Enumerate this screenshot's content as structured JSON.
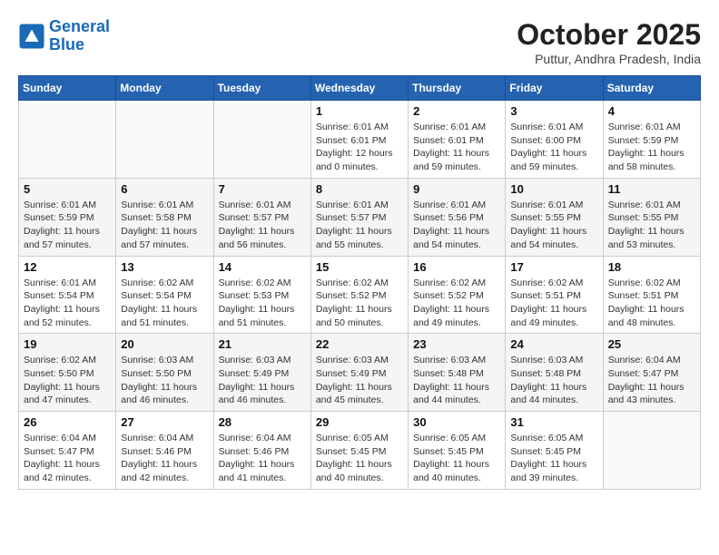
{
  "header": {
    "logo_line1": "General",
    "logo_line2": "Blue",
    "month": "October 2025",
    "location": "Puttur, Andhra Pradesh, India"
  },
  "weekdays": [
    "Sunday",
    "Monday",
    "Tuesday",
    "Wednesday",
    "Thursday",
    "Friday",
    "Saturday"
  ],
  "weeks": [
    [
      {
        "day": "",
        "info": ""
      },
      {
        "day": "",
        "info": ""
      },
      {
        "day": "",
        "info": ""
      },
      {
        "day": "1",
        "info": "Sunrise: 6:01 AM\nSunset: 6:01 PM\nDaylight: 12 hours\nand 0 minutes."
      },
      {
        "day": "2",
        "info": "Sunrise: 6:01 AM\nSunset: 6:01 PM\nDaylight: 11 hours\nand 59 minutes."
      },
      {
        "day": "3",
        "info": "Sunrise: 6:01 AM\nSunset: 6:00 PM\nDaylight: 11 hours\nand 59 minutes."
      },
      {
        "day": "4",
        "info": "Sunrise: 6:01 AM\nSunset: 5:59 PM\nDaylight: 11 hours\nand 58 minutes."
      }
    ],
    [
      {
        "day": "5",
        "info": "Sunrise: 6:01 AM\nSunset: 5:59 PM\nDaylight: 11 hours\nand 57 minutes."
      },
      {
        "day": "6",
        "info": "Sunrise: 6:01 AM\nSunset: 5:58 PM\nDaylight: 11 hours\nand 57 minutes."
      },
      {
        "day": "7",
        "info": "Sunrise: 6:01 AM\nSunset: 5:57 PM\nDaylight: 11 hours\nand 56 minutes."
      },
      {
        "day": "8",
        "info": "Sunrise: 6:01 AM\nSunset: 5:57 PM\nDaylight: 11 hours\nand 55 minutes."
      },
      {
        "day": "9",
        "info": "Sunrise: 6:01 AM\nSunset: 5:56 PM\nDaylight: 11 hours\nand 54 minutes."
      },
      {
        "day": "10",
        "info": "Sunrise: 6:01 AM\nSunset: 5:55 PM\nDaylight: 11 hours\nand 54 minutes."
      },
      {
        "day": "11",
        "info": "Sunrise: 6:01 AM\nSunset: 5:55 PM\nDaylight: 11 hours\nand 53 minutes."
      }
    ],
    [
      {
        "day": "12",
        "info": "Sunrise: 6:01 AM\nSunset: 5:54 PM\nDaylight: 11 hours\nand 52 minutes."
      },
      {
        "day": "13",
        "info": "Sunrise: 6:02 AM\nSunset: 5:54 PM\nDaylight: 11 hours\nand 51 minutes."
      },
      {
        "day": "14",
        "info": "Sunrise: 6:02 AM\nSunset: 5:53 PM\nDaylight: 11 hours\nand 51 minutes."
      },
      {
        "day": "15",
        "info": "Sunrise: 6:02 AM\nSunset: 5:52 PM\nDaylight: 11 hours\nand 50 minutes."
      },
      {
        "day": "16",
        "info": "Sunrise: 6:02 AM\nSunset: 5:52 PM\nDaylight: 11 hours\nand 49 minutes."
      },
      {
        "day": "17",
        "info": "Sunrise: 6:02 AM\nSunset: 5:51 PM\nDaylight: 11 hours\nand 49 minutes."
      },
      {
        "day": "18",
        "info": "Sunrise: 6:02 AM\nSunset: 5:51 PM\nDaylight: 11 hours\nand 48 minutes."
      }
    ],
    [
      {
        "day": "19",
        "info": "Sunrise: 6:02 AM\nSunset: 5:50 PM\nDaylight: 11 hours\nand 47 minutes."
      },
      {
        "day": "20",
        "info": "Sunrise: 6:03 AM\nSunset: 5:50 PM\nDaylight: 11 hours\nand 46 minutes."
      },
      {
        "day": "21",
        "info": "Sunrise: 6:03 AM\nSunset: 5:49 PM\nDaylight: 11 hours\nand 46 minutes."
      },
      {
        "day": "22",
        "info": "Sunrise: 6:03 AM\nSunset: 5:49 PM\nDaylight: 11 hours\nand 45 minutes."
      },
      {
        "day": "23",
        "info": "Sunrise: 6:03 AM\nSunset: 5:48 PM\nDaylight: 11 hours\nand 44 minutes."
      },
      {
        "day": "24",
        "info": "Sunrise: 6:03 AM\nSunset: 5:48 PM\nDaylight: 11 hours\nand 44 minutes."
      },
      {
        "day": "25",
        "info": "Sunrise: 6:04 AM\nSunset: 5:47 PM\nDaylight: 11 hours\nand 43 minutes."
      }
    ],
    [
      {
        "day": "26",
        "info": "Sunrise: 6:04 AM\nSunset: 5:47 PM\nDaylight: 11 hours\nand 42 minutes."
      },
      {
        "day": "27",
        "info": "Sunrise: 6:04 AM\nSunset: 5:46 PM\nDaylight: 11 hours\nand 42 minutes."
      },
      {
        "day": "28",
        "info": "Sunrise: 6:04 AM\nSunset: 5:46 PM\nDaylight: 11 hours\nand 41 minutes."
      },
      {
        "day": "29",
        "info": "Sunrise: 6:05 AM\nSunset: 5:45 PM\nDaylight: 11 hours\nand 40 minutes."
      },
      {
        "day": "30",
        "info": "Sunrise: 6:05 AM\nSunset: 5:45 PM\nDaylight: 11 hours\nand 40 minutes."
      },
      {
        "day": "31",
        "info": "Sunrise: 6:05 AM\nSunset: 5:45 PM\nDaylight: 11 hours\nand 39 minutes."
      },
      {
        "day": "",
        "info": ""
      }
    ]
  ]
}
